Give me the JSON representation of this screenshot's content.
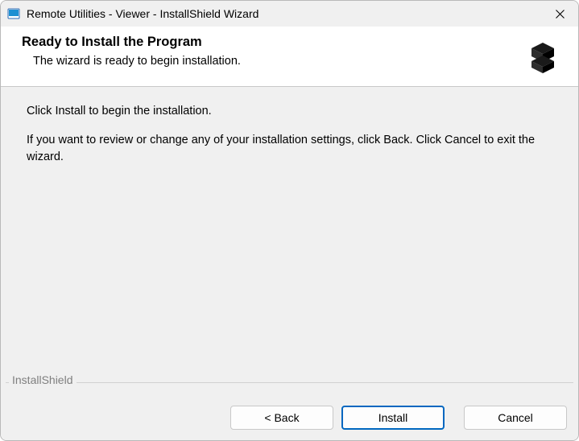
{
  "window": {
    "title": "Remote Utilities - Viewer - InstallShield Wizard"
  },
  "header": {
    "title": "Ready to Install the Program",
    "subtitle": "The wizard is ready to begin installation."
  },
  "body": {
    "line1": "Click Install to begin the installation.",
    "line2": "If you want to review or change any of your installation settings, click Back. Click Cancel to exit the wizard."
  },
  "brand": {
    "label": "InstallShield"
  },
  "buttons": {
    "back": "< Back",
    "install": "Install",
    "cancel": "Cancel"
  }
}
